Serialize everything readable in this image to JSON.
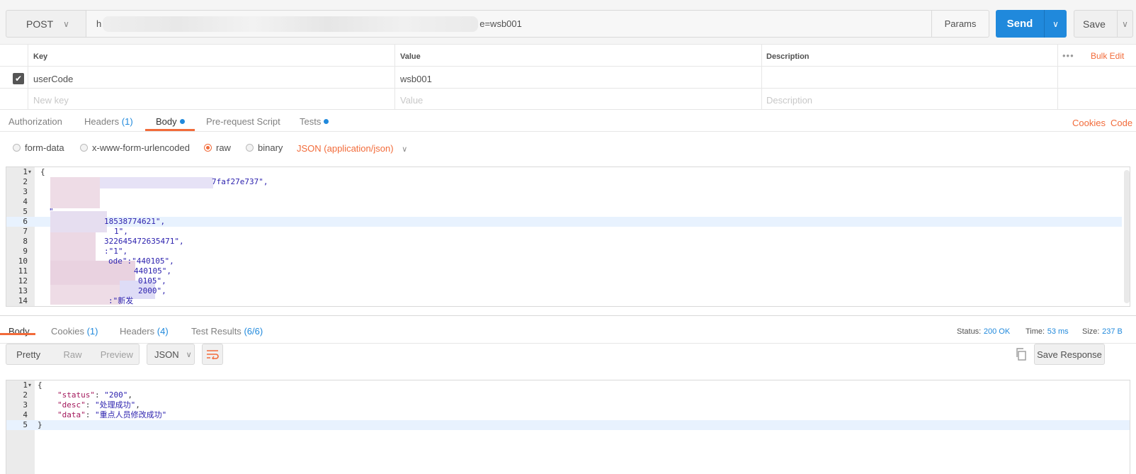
{
  "request": {
    "method": "POST",
    "url_start": "h",
    "url_end": "e=wsb001",
    "params_label": "Params",
    "send_label": "Send",
    "save_label": "Save"
  },
  "params_table": {
    "headers": {
      "key": "Key",
      "value": "Value",
      "description": "Description"
    },
    "bulk_edit": "Bulk Edit",
    "rows": [
      {
        "key": "userCode",
        "value": "wsb001",
        "checked": true
      }
    ],
    "placeholders": {
      "key": "New key",
      "value": "Value",
      "description": "Description"
    }
  },
  "request_tabs": {
    "authorization": "Authorization",
    "headers": "Headers",
    "headers_count": "(1)",
    "body": "Body",
    "prerequest": "Pre-request Script",
    "tests": "Tests",
    "cookies": "Cookies",
    "code": "Code"
  },
  "body_types": {
    "form_data": "form-data",
    "urlencoded": "x-www-form-urlencoded",
    "raw": "raw",
    "binary": "binary",
    "selected": "raw",
    "content_type": "JSON (application/json)"
  },
  "request_editor": {
    "line_numbers": [
      "1",
      "2",
      "3",
      "4",
      "5",
      "6",
      "7",
      "8",
      "9",
      "10",
      "11",
      "12",
      "13",
      "14"
    ],
    "lines": [
      "{",
      "7faf27e737\",",
      "",
      "",
      "\"",
      "18538774621\",",
      "1\",",
      "322645472635471\",",
      ":\"1\",",
      "ode\":\"440105\",",
      "440105\",",
      "0105\",",
      "2000\",",
      ":\"新发"
    ],
    "highlighted_line": 6
  },
  "response_tabs": {
    "body": "Body",
    "cookies": "Cookies",
    "cookies_count": "(1)",
    "headers": "Headers",
    "headers_count": "(4)",
    "tests": "Test Results",
    "tests_count": "(6/6)"
  },
  "response_meta": {
    "status_label": "Status:",
    "status_value": "200 OK",
    "time_label": "Time:",
    "time_value": "53 ms",
    "size_label": "Size:",
    "size_value": "237 B"
  },
  "response_toolbar": {
    "pretty": "Pretty",
    "raw": "Raw",
    "preview": "Preview",
    "format": "JSON",
    "save_response": "Save Response"
  },
  "response_editor": {
    "line_numbers": [
      "1",
      "2",
      "3",
      "4",
      "5"
    ],
    "status_key": "\"status\"",
    "status_val": "\"200\"",
    "desc_key": "\"desc\"",
    "desc_val": "\"处理成功\"",
    "data_key": "\"data\"",
    "data_val": "\"重点人员修改成功\"",
    "highlighted_line": 5
  },
  "colors": {
    "accent": "#f26b3a",
    "primary": "#2089dc",
    "json_key": "#a3185c",
    "json_string": "#2a1fad"
  }
}
